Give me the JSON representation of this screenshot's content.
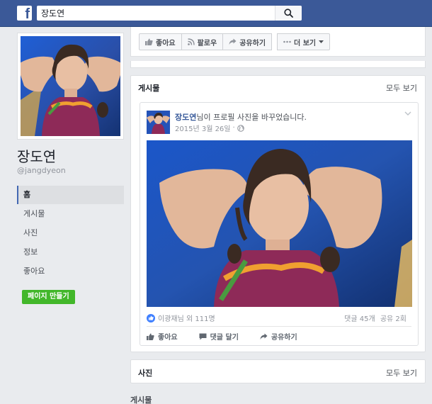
{
  "topbar": {
    "logo": "f",
    "search_value": "장도연",
    "search_icon": "search-icon"
  },
  "profile": {
    "name": "장도연",
    "handle": "@jangdyeon"
  },
  "left_nav": {
    "items": [
      {
        "label": "홈",
        "active": true
      },
      {
        "label": "게시물",
        "active": false
      },
      {
        "label": "사진",
        "active": false
      },
      {
        "label": "정보",
        "active": false
      },
      {
        "label": "좋아요",
        "active": false
      }
    ],
    "create_page_label": "페이지 만들기"
  },
  "action_bar": {
    "like_label": "좋아요",
    "follow_label": "팔로우",
    "share_label": "공유하기",
    "more_label": "더 보기"
  },
  "posts_section": {
    "title": "게시물",
    "see_all": "모두 보기",
    "post": {
      "author": "장도연",
      "action_text": "님이 프로필 사진을 바꾸었습니다.",
      "date": "2015년 3월 26일",
      "reactions_text": "이광재님 외 111명",
      "comments": "댓글 45개",
      "shares": "공유 2회",
      "like_label": "좋아요",
      "comment_label": "댓글 달기",
      "share_label": "공유하기"
    }
  },
  "photos_section": {
    "title": "사진",
    "see_all": "모두 보기"
  },
  "bottom_section": {
    "title": "게시물"
  },
  "colors": {
    "topbar": "#3b5998",
    "link": "#365899",
    "create_button": "#42b72a",
    "like_badge": "#4080ff",
    "background": "#e9ebee"
  }
}
